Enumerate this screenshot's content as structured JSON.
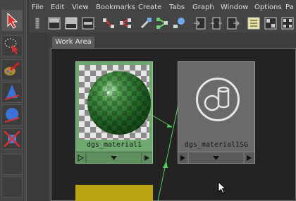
{
  "menus": [
    "File",
    "Edit",
    "View",
    "Bookmarks",
    "Create",
    "Tabs",
    "Graph",
    "Window",
    "Options",
    "Pa"
  ],
  "tab": {
    "label": "Work Area"
  },
  "nodes": {
    "material": {
      "name": "dgs_material1",
      "color": "#6fa86f"
    },
    "shading_group": {
      "name": "dgs_material1SG",
      "color": "#6a6a6a"
    }
  },
  "colors": {
    "accent_tool": "#c02020",
    "connection": "#4fd24f",
    "canvas": "#232323"
  },
  "toolbox_icons": [
    "select-arrow-icon",
    "lasso-select-icon",
    "paint-brush-icon",
    "cone-icon",
    "sphere-icon",
    "move-gizmo-icon"
  ]
}
